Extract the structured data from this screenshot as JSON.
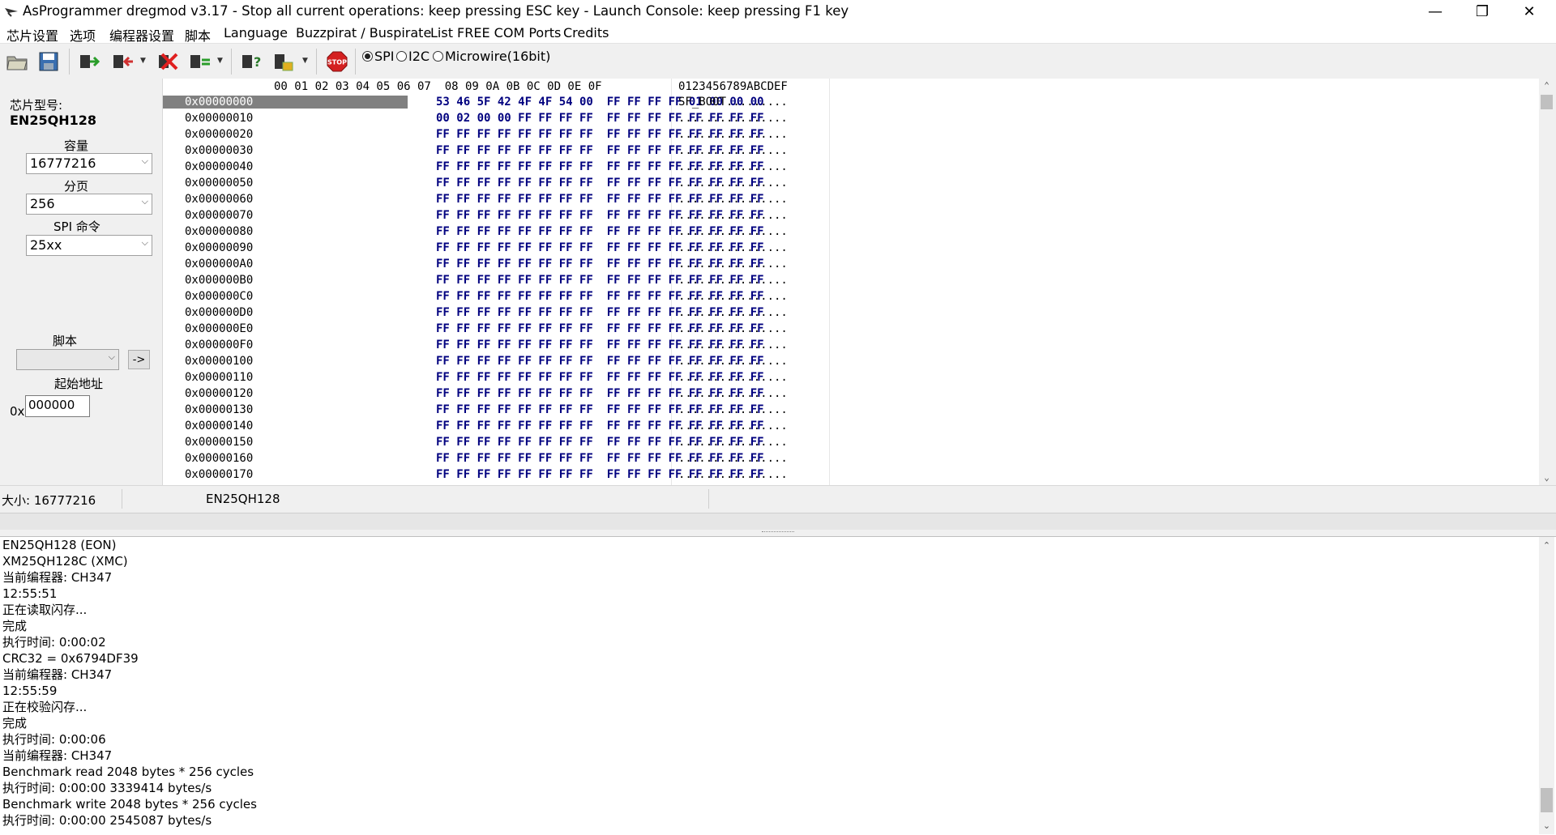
{
  "title": "AsProgrammer dregmod v3.17 - Stop all current operations: keep pressing ESC key - Launch Console: keep pressing F1 key",
  "window_controls": {
    "minimize": "—",
    "restore": "❐",
    "close": "✕"
  },
  "menu": [
    "芯片设置",
    "选项",
    "编程器设置",
    "脚本",
    "Language",
    "Buzzpirat / Buspirate",
    "List FREE COM Ports",
    "Credits"
  ],
  "toolbar": {
    "icons": [
      "open-icon",
      "save-icon",
      "read-icon",
      "write-icon",
      "erase-icon",
      "verify-icon",
      "chip-id-icon",
      "unlock-icon",
      "stop-icon"
    ],
    "stop_label": "STOP",
    "protocol_options": [
      "SPI",
      "I2C",
      "Microwire(16bit)"
    ],
    "protocol_selected": "SPI"
  },
  "left_panel": {
    "chip_model_label": "芯片型号:",
    "chip_model_value": "EN25QH128",
    "capacity_label": "容量",
    "capacity_value": "16777216",
    "page_label": "分页",
    "page_value": "256",
    "spi_cmd_label": "SPI 命令",
    "spi_cmd_value": "25xx",
    "script_label": "脚本",
    "script_value": "",
    "script_go": "->",
    "start_addr_label": "起始地址",
    "start_addr_prefix": "0x",
    "start_addr_value": "000000"
  },
  "hex": {
    "column_header": "00 01 02 03 04 05 06 07  08 09 0A 0B 0C 0D 0E 0F",
    "ascii_header": "0123456789ABCDEF",
    "rows": [
      {
        "addr": "0x00000000",
        "bytes": "53 46 5F 42 4F 4F 54 00  FF FF FF FF 01 00 00 00",
        "ascii": "SF_BOOT........."
      },
      {
        "addr": "0x00000010",
        "bytes": "00 02 00 00 FF FF FF FF  FF FF FF FF FF FF FF FF",
        "ascii": "................"
      },
      {
        "addr": "0x00000020",
        "bytes": "FF FF FF FF FF FF FF FF  FF FF FF FF FF FF FF FF",
        "ascii": "................"
      },
      {
        "addr": "0x00000030",
        "bytes": "FF FF FF FF FF FF FF FF  FF FF FF FF FF FF FF FF",
        "ascii": "................"
      },
      {
        "addr": "0x00000040",
        "bytes": "FF FF FF FF FF FF FF FF  FF FF FF FF FF FF FF FF",
        "ascii": "................"
      },
      {
        "addr": "0x00000050",
        "bytes": "FF FF FF FF FF FF FF FF  FF FF FF FF FF FF FF FF",
        "ascii": "................"
      },
      {
        "addr": "0x00000060",
        "bytes": "FF FF FF FF FF FF FF FF  FF FF FF FF FF FF FF FF",
        "ascii": "................"
      },
      {
        "addr": "0x00000070",
        "bytes": "FF FF FF FF FF FF FF FF  FF FF FF FF FF FF FF FF",
        "ascii": "................"
      },
      {
        "addr": "0x00000080",
        "bytes": "FF FF FF FF FF FF FF FF  FF FF FF FF FF FF FF FF",
        "ascii": "................"
      },
      {
        "addr": "0x00000090",
        "bytes": "FF FF FF FF FF FF FF FF  FF FF FF FF FF FF FF FF",
        "ascii": "................"
      },
      {
        "addr": "0x000000A0",
        "bytes": "FF FF FF FF FF FF FF FF  FF FF FF FF FF FF FF FF",
        "ascii": "................"
      },
      {
        "addr": "0x000000B0",
        "bytes": "FF FF FF FF FF FF FF FF  FF FF FF FF FF FF FF FF",
        "ascii": "................"
      },
      {
        "addr": "0x000000C0",
        "bytes": "FF FF FF FF FF FF FF FF  FF FF FF FF FF FF FF FF",
        "ascii": "................"
      },
      {
        "addr": "0x000000D0",
        "bytes": "FF FF FF FF FF FF FF FF  FF FF FF FF FF FF FF FF",
        "ascii": "................"
      },
      {
        "addr": "0x000000E0",
        "bytes": "FF FF FF FF FF FF FF FF  FF FF FF FF FF FF FF FF",
        "ascii": "................"
      },
      {
        "addr": "0x000000F0",
        "bytes": "FF FF FF FF FF FF FF FF  FF FF FF FF FF FF FF FF",
        "ascii": "................"
      },
      {
        "addr": "0x00000100",
        "bytes": "FF FF FF FF FF FF FF FF  FF FF FF FF FF FF FF FF",
        "ascii": "................"
      },
      {
        "addr": "0x00000110",
        "bytes": "FF FF FF FF FF FF FF FF  FF FF FF FF FF FF FF FF",
        "ascii": "................"
      },
      {
        "addr": "0x00000120",
        "bytes": "FF FF FF FF FF FF FF FF  FF FF FF FF FF FF FF FF",
        "ascii": "................"
      },
      {
        "addr": "0x00000130",
        "bytes": "FF FF FF FF FF FF FF FF  FF FF FF FF FF FF FF FF",
        "ascii": "................"
      },
      {
        "addr": "0x00000140",
        "bytes": "FF FF FF FF FF FF FF FF  FF FF FF FF FF FF FF FF",
        "ascii": "................"
      },
      {
        "addr": "0x00000150",
        "bytes": "FF FF FF FF FF FF FF FF  FF FF FF FF FF FF FF FF",
        "ascii": "................"
      },
      {
        "addr": "0x00000160",
        "bytes": "FF FF FF FF FF FF FF FF  FF FF FF FF FF FF FF FF",
        "ascii": "................"
      },
      {
        "addr": "0x00000170",
        "bytes": "FF FF FF FF FF FF FF FF  FF FF FF FF FF FF FF FF",
        "ascii": "................"
      }
    ]
  },
  "status": {
    "size_label": "大小: 16777216",
    "chip": "EN25QH128"
  },
  "console_lines": [
    "EN25QH128 (EON)",
    "XM25QH128C (XMC)",
    "当前编程器: CH347",
    "12:55:51",
    "正在读取闪存...",
    "完成",
    "执行时间: 0:00:02",
    "CRC32 = 0x6794DF39",
    "当前编程器: CH347",
    "12:55:59",
    "正在校验闪存...",
    "完成",
    "执行时间: 0:00:06",
    "当前编程器: CH347",
    "Benchmark read 2048 bytes * 256 cycles",
    "执行时间: 0:00:00 3339414 bytes/s",
    "Benchmark write 2048 bytes * 256 cycles",
    "执行时间: 0:00:00 2545087 bytes/s"
  ]
}
